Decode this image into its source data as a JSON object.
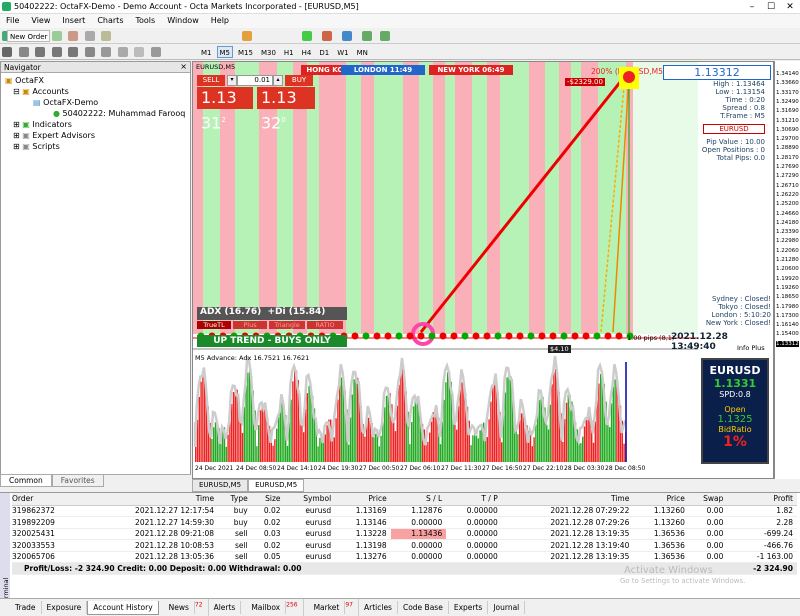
{
  "window": {
    "title": "50402222: OctaFX-Demo - Demo Account - Octa Markets Incorporated - [EURUSD,M5]"
  },
  "menu": [
    "File",
    "View",
    "Insert",
    "Charts",
    "Tools",
    "Window",
    "Help"
  ],
  "toolbar": {
    "new_order": "New Order",
    "timeframes": [
      "M1",
      "M5",
      "M15",
      "M30",
      "H1",
      "H4",
      "D1",
      "W1",
      "MN"
    ]
  },
  "navigator": {
    "title": "Navigator",
    "root": "OctaFX",
    "accounts": "Accounts",
    "server": "OctaFX-Demo",
    "account": "50402222: Muhammad Farooq",
    "indicators": "Indicators",
    "experts": "Expert Advisors",
    "scripts": "Scripts",
    "tabs": [
      "Common",
      "Favorites"
    ]
  },
  "chart": {
    "symbol_tf": "EURUSD,M5",
    "sell": "SELL",
    "buy": "BUY",
    "lot": "0.01",
    "bid_big": "1.13 31",
    "bid_sup": "2",
    "ask_big": "1.13 32",
    "ask_sup": "0",
    "sessions": [
      "HONG KONG 19:49",
      "LONDON 11:49",
      "NEW YORK 06:49"
    ],
    "pct": "200% (EURUSD,M5) : 2623 Points",
    "loss": "-$2329.00",
    "adx": "ADX (16.76)",
    "di": "+Di (15.84)",
    "buttons": [
      "TrueTL",
      "Plus",
      "Triangle",
      "RATIO"
    ],
    "trend": "UP TREND - BUYS ONLY",
    "small_val": "$4.10",
    "pips": "1.00 pips (8,1)",
    "datetime": "2021.12.28  13:49:40",
    "info_plus": "Info Plus",
    "info": {
      "price": "1.13312",
      "high": "High : 1.13464",
      "low": "Low : 1.13154",
      "time": "Time : 0:20",
      "spread": "Spread : 0.8",
      "tframe": "T.Frame : M5",
      "sym": "EURUSD",
      "pipval": "Pip Value : 10.00",
      "openpos": "Open Positions : 0",
      "totalpips": "Total Pips: 0.0"
    },
    "sessions_status": [
      "Sydney : Closed!",
      "Tokyo : Closed!",
      "London : 5:10:20",
      "New York : Closed!"
    ],
    "indicator_label": "M5 Advance: Adx 16.7521 16.7621",
    "xlabels": [
      "24 Dec 2021",
      "24 Dec 08:50",
      "24 Dec 14:10",
      "24 Dec 19:30",
      "27 Dec 00:50",
      "27 Dec 06:10",
      "27 Dec 11:30",
      "27 Dec 16:50",
      "27 Dec 22:10",
      "28 Dec 03:30",
      "28 Dec 08:50"
    ],
    "yprices": [
      "1.34140",
      "1.33660",
      "1.33170",
      "1.32490",
      "1.31690",
      "1.31210",
      "1.30690",
      "1.29700",
      "1.28890",
      "1.28170",
      "1.27690",
      "1.27290",
      "1.26710",
      "1.26220",
      "1.25200",
      "1.24660",
      "1.24180",
      "1.23390",
      "1.22980",
      "1.22060",
      "1.21280",
      "1.20600",
      "1.19920",
      "1.19260",
      "1.18650",
      "1.17980",
      "1.17300",
      "1.16140",
      "1.15400",
      "1.13312"
    ],
    "box": {
      "sym": "EURUSD",
      "bid": "1.1331",
      "spd": "SPD:0.8",
      "open_label": "Open",
      "open": "1.1325",
      "ratio_label": "BidRatio",
      "ratio": "1%"
    },
    "bg_colors": [
      "#fff",
      "#f9b0b8",
      "#b6f2b6"
    ]
  },
  "chart_tabs": [
    "EURUSD,M5",
    "EURUSD,M5"
  ],
  "terminal": {
    "headers": [
      "Order",
      "Time",
      "Type",
      "Size",
      "Symbol",
      "Price",
      "S / L",
      "T / P",
      "Time",
      "Price",
      "Swap",
      "Profit"
    ],
    "rows": [
      [
        "319862372",
        "2021.12.27 12:17:54",
        "buy",
        "0.02",
        "eurusd",
        "1.13169",
        "1.12876",
        "0.00000",
        "2021.12.28 07:29:22",
        "1.13260",
        "0.00",
        "1.82"
      ],
      [
        "319892209",
        "2021.12.27 14:59:30",
        "buy",
        "0.02",
        "eurusd",
        "1.13146",
        "0.00000",
        "0.00000",
        "2021.12.28 07:29:26",
        "1.13260",
        "0.00",
        "2.28"
      ],
      [
        "320025431",
        "2021.12.28 09:21:08",
        "sell",
        "0.03",
        "eurusd",
        "1.13228",
        "1.13436",
        "0.00000",
        "2021.12.28 13:19:35",
        "1.36536",
        "0.00",
        "-699.24"
      ],
      [
        "320033553",
        "2021.12.28 10:08:53",
        "sell",
        "0.02",
        "eurusd",
        "1.13198",
        "0.00000",
        "0.00000",
        "2021.12.28 13:19:40",
        "1.36536",
        "0.00",
        "-466.76"
      ],
      [
        "320065706",
        "2021.12.28 13:05:36",
        "sell",
        "0.05",
        "eurusd",
        "1.13276",
        "0.00000",
        "0.00000",
        "2021.12.28 13:19:35",
        "1.36536",
        "0.00",
        "-1 163.00"
      ]
    ],
    "summary": "Profit/Loss: -2 324.90  Credit: 0.00  Deposit: 0.00  Withdrawal: 0.00",
    "summary_total": "-2 324.90",
    "watermark1": "Activate Windows",
    "watermark2": "Go to Settings to activate Windows.",
    "tabs": [
      "Trade",
      "Exposure",
      "Account History",
      "News",
      "Alerts",
      "Mailbox",
      "Market",
      "Articles",
      "Code Base",
      "Experts",
      "Journal"
    ],
    "badges": {
      "news": "72",
      "mailbox": "256",
      "market": "97"
    },
    "side": "Terminal"
  }
}
